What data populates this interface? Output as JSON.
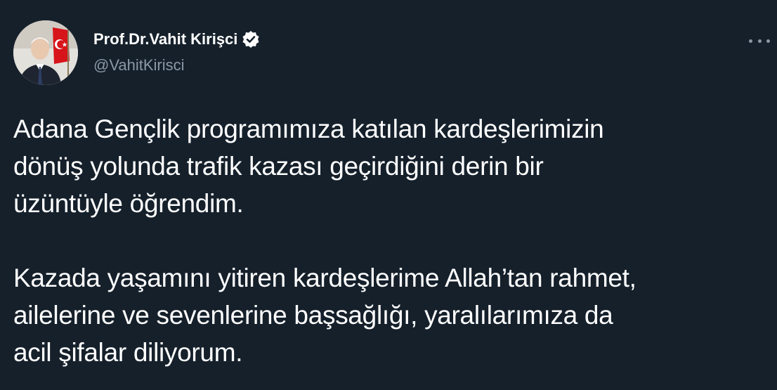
{
  "author": {
    "display_name": "Prof.Dr.Vahit Kirişci",
    "handle": "@VahitKirisci",
    "verified": true,
    "avatar_icon": "profile-photo-with-turkish-flag"
  },
  "menu": {
    "icon": "more-options-icon"
  },
  "tweet": {
    "paragraphs": [
      {
        "lines": [
          "Adana Gençlik programımıza katılan kardeşlerimizin",
          "dönüş yolunda trafik kazası geçirdiğini derin bir",
          "üzüntüyle öğrendim."
        ]
      },
      {
        "lines": [
          "Kazada yaşamını yitiren kardeşlerime Allah’tan rahmet,",
          "ailelerine ve sevenlerine başsağlığı, yaralılarımıza da",
          "acil şifalar diliyorum."
        ]
      }
    ]
  },
  "colors": {
    "background": "#15202b",
    "primary_text": "#ffffff",
    "secondary_text": "#8b98a5"
  }
}
